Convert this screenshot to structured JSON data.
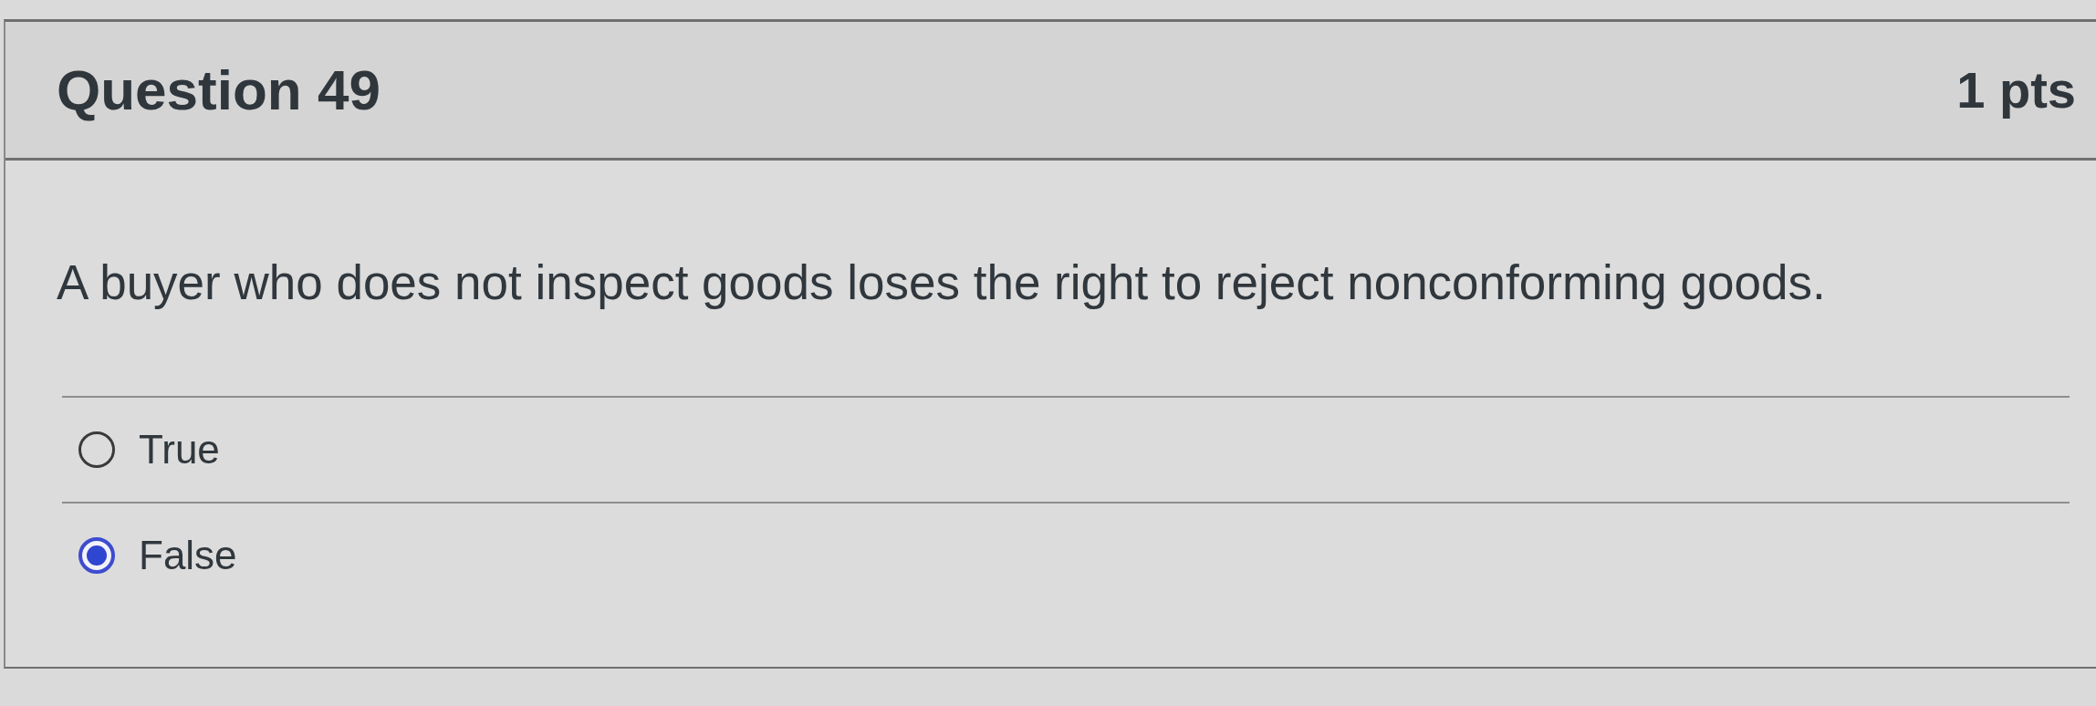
{
  "question": {
    "title": "Question 49",
    "points": "1 pts",
    "text": "A buyer who does not inspect goods loses the right to reject nonconforming goods."
  },
  "answers": [
    {
      "label": "True",
      "selected": false
    },
    {
      "label": "False",
      "selected": true
    }
  ]
}
